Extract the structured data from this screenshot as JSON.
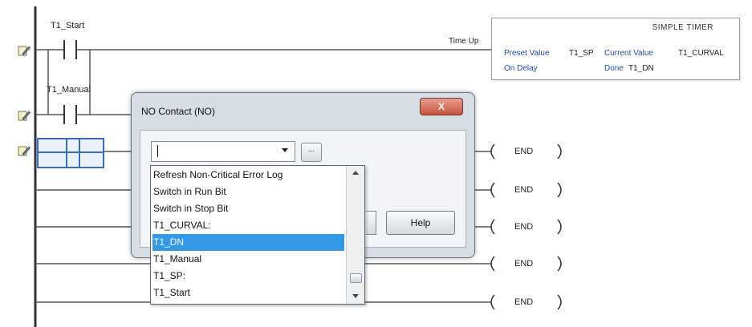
{
  "ladder": {
    "contacts": {
      "t1_start_label": "T1_Start",
      "t1_manual_label": "T1_Manual"
    },
    "time_up_label": "Time Up",
    "end_label": "END"
  },
  "timer": {
    "title": "SIMPLE TIMER",
    "preset_label": "Preset Value",
    "preset_value": "T1_SP",
    "current_label": "Current Value",
    "current_value": "T1_CURVAL",
    "on_delay_label": "On Delay",
    "done_label": "Done",
    "done_value": "T1_DN"
  },
  "dialog": {
    "title": "NO Contact (NO)",
    "close_label": "X",
    "combo_value": "",
    "browse_label": "...",
    "help_label": "Help"
  },
  "dropdown": {
    "items": [
      "Refresh Non-Critical Error Log",
      "Switch in Run Bit",
      "Switch in Stop Bit",
      "T1_CURVAL:",
      "T1_DN",
      "T1_Manual",
      "T1_SP:",
      "T1_Start"
    ],
    "selected": "T1_DN"
  },
  "icons": {
    "rung_edit": "pencil-note-icon"
  },
  "colors": {
    "selection": "#3399e6",
    "timer_text": "#1f4fa0",
    "close_button": "#c9503b"
  }
}
